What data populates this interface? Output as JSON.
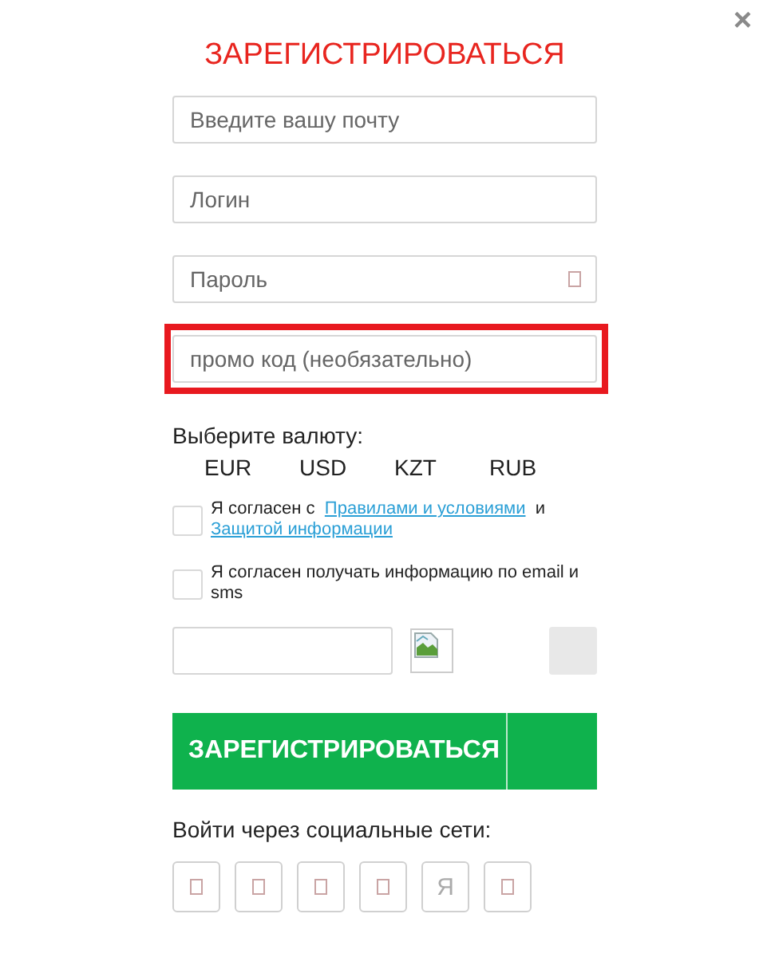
{
  "close_button": {
    "label": "×"
  },
  "title": "ЗАРЕГИСТРИРОВАТЬСЯ",
  "fields": [
    {
      "kind": "text",
      "placeholder": "Введите вашу почту",
      "highlighted": false
    },
    {
      "kind": "text",
      "placeholder": "Логин",
      "highlighted": false
    },
    {
      "kind": "password",
      "placeholder": "Пароль",
      "highlighted": false
    },
    {
      "kind": "text",
      "placeholder": "промо код (необязательно)",
      "highlighted": true
    }
  ],
  "currency": {
    "label": "Выберите валюту:",
    "options": [
      "EUR",
      "USD",
      "KZT",
      "RUB"
    ]
  },
  "agreements": [
    {
      "checked": false,
      "segments": [
        {
          "kind": "text",
          "text": "Я согласен с"
        },
        {
          "kind": "link",
          "text": "Правилами и условиями"
        },
        {
          "kind": "text",
          "text": "и"
        },
        {
          "kind": "link",
          "text": "Защитой информации"
        }
      ]
    },
    {
      "checked": false,
      "segments": [
        {
          "kind": "text",
          "text": "Я согласен получать информацию по email и sms"
        }
      ]
    }
  ],
  "submit_button": {
    "label": "ЗАРЕГИСТРИРОВАТЬСЯ"
  },
  "social": {
    "label": "Войти через социальные сети:",
    "buttons": [
      {
        "kind": "icon"
      },
      {
        "kind": "icon"
      },
      {
        "kind": "icon"
      },
      {
        "kind": "icon"
      },
      {
        "kind": "letter",
        "label": "Я"
      },
      {
        "kind": "icon"
      }
    ]
  }
}
